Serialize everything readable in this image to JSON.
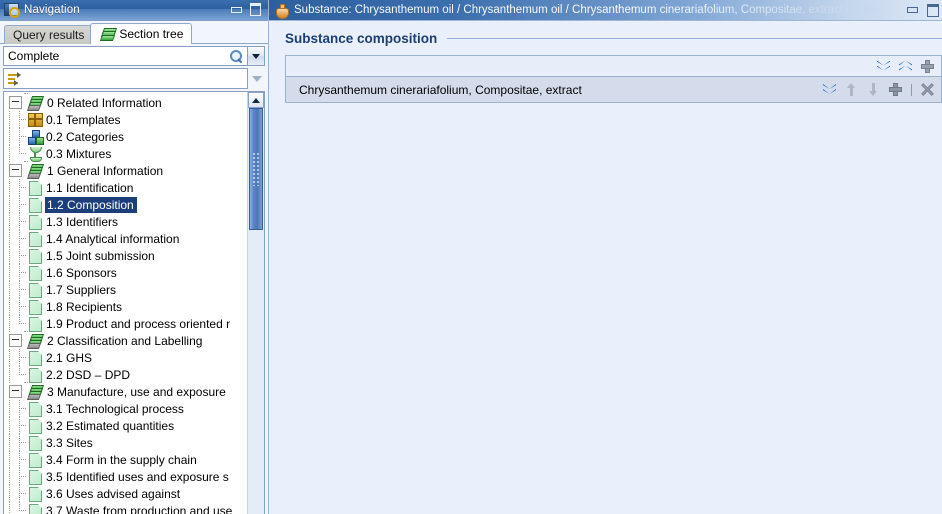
{
  "nav_panel": {
    "title": "Navigation",
    "title_icon": "navigation-icon",
    "window_buttons": {
      "minimize": "minimize-icon",
      "maximize": "maximize-icon"
    },
    "tabs": [
      {
        "label": "Query results",
        "active": false,
        "icon": null
      },
      {
        "label": "Section tree",
        "active": true,
        "icon": "green-books-icon"
      }
    ],
    "filter": {
      "value": "Complete",
      "search_icon": "magnifier-icon",
      "dropdown_icon": "chevron-down-icon"
    },
    "filter2": {
      "value": "",
      "icon": "flow-filter-icon",
      "expand_icon": "triangle-down-icon"
    },
    "scrollbar": {
      "up_arrow": "scroll-up-arrow-icon"
    },
    "tree": [
      {
        "label": "0 Related Information",
        "level": 0,
        "icon": "green-books-icon",
        "toggle": "expanded",
        "selected": false
      },
      {
        "label": "0.1 Templates",
        "level": 1,
        "icon": "template-box-icon",
        "toggle": null,
        "selected": false
      },
      {
        "label": "0.2 Categories",
        "level": 1,
        "icon": "categories-icon",
        "toggle": null,
        "selected": false
      },
      {
        "label": "0.3 Mixtures",
        "level": 1,
        "icon": "mixtures-icon",
        "toggle": null,
        "selected": false
      },
      {
        "label": "1 General Information",
        "level": 0,
        "icon": "green-books-icon",
        "toggle": "expanded",
        "selected": false
      },
      {
        "label": "1.1 Identification",
        "level": 1,
        "icon": "document-icon",
        "toggle": null,
        "selected": false
      },
      {
        "label": "1.2 Composition",
        "level": 1,
        "icon": "document-icon",
        "toggle": null,
        "selected": true
      },
      {
        "label": "1.3 Identifiers",
        "level": 1,
        "icon": "document-icon",
        "toggle": null,
        "selected": false
      },
      {
        "label": "1.4 Analytical information",
        "level": 1,
        "icon": "document-icon",
        "toggle": null,
        "selected": false
      },
      {
        "label": "1.5 Joint submission",
        "level": 1,
        "icon": "document-icon",
        "toggle": null,
        "selected": false
      },
      {
        "label": "1.6 Sponsors",
        "level": 1,
        "icon": "document-icon",
        "toggle": null,
        "selected": false
      },
      {
        "label": "1.7 Suppliers",
        "level": 1,
        "icon": "document-icon",
        "toggle": null,
        "selected": false
      },
      {
        "label": "1.8 Recipients",
        "level": 1,
        "icon": "document-icon",
        "toggle": null,
        "selected": false
      },
      {
        "label": "1.9 Product and process oriented r",
        "level": 1,
        "icon": "document-icon",
        "toggle": null,
        "selected": false
      },
      {
        "label": "2 Classification and Labelling",
        "level": 0,
        "icon": "green-books-icon",
        "toggle": "expanded",
        "selected": false
      },
      {
        "label": "2.1 GHS",
        "level": 1,
        "icon": "document-icon",
        "toggle": null,
        "selected": false
      },
      {
        "label": "2.2 DSD – DPD",
        "level": 1,
        "icon": "document-icon",
        "toggle": null,
        "selected": false
      },
      {
        "label": "3 Manufacture, use and exposure",
        "level": 0,
        "icon": "green-books-icon",
        "toggle": "expanded",
        "selected": false
      },
      {
        "label": "3.1 Technological process",
        "level": 1,
        "icon": "document-icon",
        "toggle": null,
        "selected": false
      },
      {
        "label": "3.2 Estimated quantities",
        "level": 1,
        "icon": "document-icon",
        "toggle": null,
        "selected": false
      },
      {
        "label": "3.3 Sites",
        "level": 1,
        "icon": "document-icon",
        "toggle": null,
        "selected": false
      },
      {
        "label": "3.4 Form in the supply chain",
        "level": 1,
        "icon": "document-icon",
        "toggle": null,
        "selected": false
      },
      {
        "label": "3.5 Identified uses and exposure s",
        "level": 1,
        "icon": "document-icon",
        "toggle": null,
        "selected": false
      },
      {
        "label": "3.6 Uses advised against",
        "level": 1,
        "icon": "document-icon",
        "toggle": null,
        "selected": false
      },
      {
        "label": "3.7 Waste from production and use",
        "level": 1,
        "icon": "document-icon",
        "toggle": null,
        "selected": false
      }
    ]
  },
  "content_panel": {
    "title": "Substance: Chrysanthemum oil / Chrysanthemum oil / Chrysanthemum cinerariafolium, Compositae, extract / Com",
    "title_icon": "substance-flask-icon",
    "window_buttons": {
      "minimize": "minimize-icon",
      "maximize": "maximize-icon"
    },
    "section_title": "Substance composition",
    "table": {
      "header_icons": [
        {
          "name": "collapse-all-icon",
          "glyph": "double-chevron-down",
          "enabled": true
        },
        {
          "name": "expand-all-icon",
          "glyph": "double-chevron-up",
          "enabled": true
        },
        {
          "name": "add-block-icon",
          "glyph": "plus",
          "enabled": true
        }
      ],
      "rows": [
        {
          "label": "Chrysanthemum cinerariafolium, Compositae, extract",
          "icons": [
            {
              "name": "expand-row-icon",
              "glyph": "double-chevron-down",
              "enabled": true
            },
            {
              "name": "move-up-icon",
              "glyph": "arrow-up",
              "enabled": false
            },
            {
              "name": "move-down-icon",
              "glyph": "arrow-down",
              "enabled": false
            },
            {
              "name": "add-row-icon",
              "glyph": "plus",
              "enabled": false
            },
            {
              "name": "separator",
              "glyph": "separator",
              "enabled": false
            },
            {
              "name": "delete-row-icon",
              "glyph": "x-mark",
              "enabled": false
            }
          ]
        }
      ]
    }
  },
  "colors": {
    "titlebar_blue": "#2c5f9e",
    "selection_blue": "#1c3f7a",
    "heading_blue": "#1c3f73",
    "content_bg": "#e9f0fb",
    "row_bg": "#d4dceb",
    "accent_icon_blue": "#1a62c4"
  }
}
